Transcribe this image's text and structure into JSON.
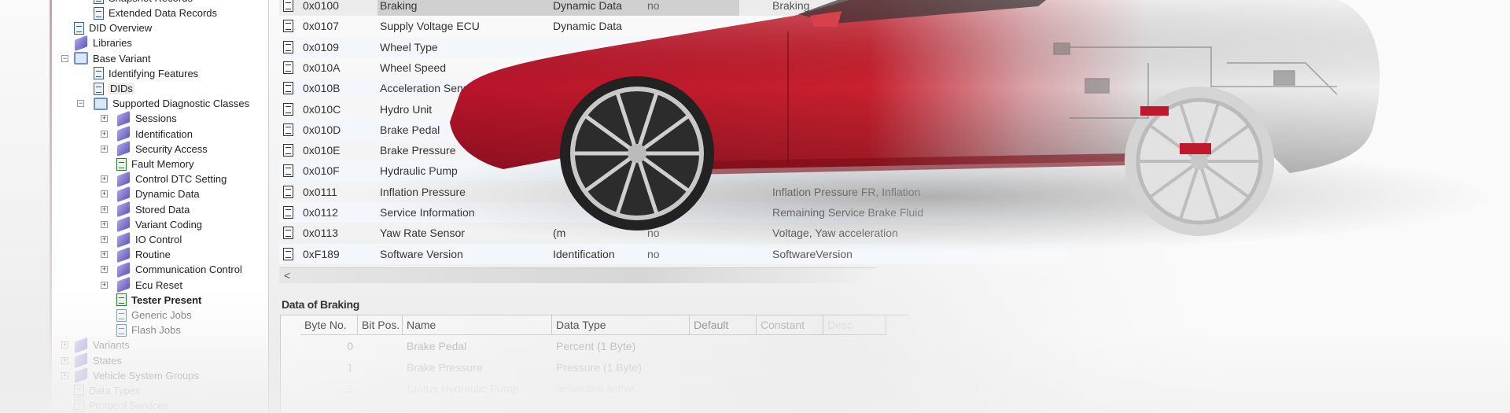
{
  "tree": [
    {
      "label": "Snapshot Records",
      "depth": 1,
      "icon": "document-icon",
      "exp": "",
      "style": "normal",
      "partial": true
    },
    {
      "label": "Extended Data Records",
      "depth": 1,
      "icon": "document-icon",
      "exp": "",
      "style": "normal"
    },
    {
      "label": "DID Overview",
      "depth": 0,
      "icon": "document-icon",
      "exp": "",
      "style": "normal"
    },
    {
      "label": "Libraries",
      "depth": 0,
      "icon": "book-icon",
      "exp": "",
      "style": "normal"
    },
    {
      "label": "Base Variant",
      "depth": 0,
      "icon": "open-book-icon",
      "exp": "-",
      "style": "normal"
    },
    {
      "label": "Identifying Features",
      "depth": 1,
      "icon": "document-icon",
      "exp": "",
      "style": "normal"
    },
    {
      "label": "DIDs",
      "depth": 1,
      "icon": "document-icon",
      "exp": "",
      "style": "selected"
    },
    {
      "label": "Supported Diagnostic Classes",
      "depth": 1,
      "icon": "open-book-icon",
      "exp": "-",
      "style": "normal"
    },
    {
      "label": "Sessions",
      "depth": 2,
      "icon": "book-icon",
      "exp": "+",
      "style": "normal"
    },
    {
      "label": "Identification",
      "depth": 2,
      "icon": "book-icon",
      "exp": "+",
      "style": "normal"
    },
    {
      "label": "Security Access",
      "depth": 2,
      "icon": "book-icon",
      "exp": "+",
      "style": "normal"
    },
    {
      "label": "Fault Memory",
      "depth": 2,
      "icon": "green-document-icon",
      "exp": "",
      "style": "normal"
    },
    {
      "label": "Control DTC Setting",
      "depth": 2,
      "icon": "book-icon",
      "exp": "+",
      "style": "normal"
    },
    {
      "label": "Dynamic Data",
      "depth": 2,
      "icon": "book-icon",
      "exp": "+",
      "style": "normal"
    },
    {
      "label": "Stored Data",
      "depth": 2,
      "icon": "book-icon",
      "exp": "+",
      "style": "normal"
    },
    {
      "label": "Variant Coding",
      "depth": 2,
      "icon": "book-icon",
      "exp": "+",
      "style": "normal"
    },
    {
      "label": "IO Control",
      "depth": 2,
      "icon": "book-icon",
      "exp": "+",
      "style": "normal"
    },
    {
      "label": "Routine",
      "depth": 2,
      "icon": "book-icon",
      "exp": "+",
      "style": "normal"
    },
    {
      "label": "Communication Control",
      "depth": 2,
      "icon": "book-icon",
      "exp": "+",
      "style": "normal"
    },
    {
      "label": "Ecu Reset",
      "depth": 2,
      "icon": "book-icon",
      "exp": "+",
      "style": "normal"
    },
    {
      "label": "Tester Present",
      "depth": 2,
      "icon": "green-document-icon",
      "exp": "",
      "style": "bold"
    },
    {
      "label": "Generic Jobs",
      "depth": 2,
      "icon": "job-document-icon",
      "exp": "",
      "style": "dim"
    },
    {
      "label": "Flash Jobs",
      "depth": 2,
      "icon": "job-document-icon",
      "exp": "",
      "style": "dim"
    },
    {
      "label": "Variants",
      "depth": 0,
      "icon": "book-icon",
      "exp": "+",
      "style": "faded"
    },
    {
      "label": "States",
      "depth": 0,
      "icon": "book-icon",
      "exp": "+",
      "style": "faded"
    },
    {
      "label": "Vehicle System Groups",
      "depth": 0,
      "icon": "book-icon",
      "exp": "+",
      "style": "faded"
    },
    {
      "label": "Data Types",
      "depth": 0,
      "icon": "document-icon",
      "exp": "",
      "style": "faded2"
    },
    {
      "label": "Protocol Services",
      "depth": 0,
      "icon": "document-icon",
      "exp": "",
      "style": "faded2"
    }
  ],
  "dids": [
    {
      "id": "0x0100",
      "name": "Braking",
      "cls": "Dynamic Data",
      "no": "no",
      "data": "Braking"
    },
    {
      "id": "0x0107",
      "name": "Supply Voltage ECU",
      "cls": "Dynamic Data",
      "no": "",
      "data": ""
    },
    {
      "id": "0x0109",
      "name": "Wheel Type",
      "cls": "",
      "no": "",
      "data": ""
    },
    {
      "id": "0x010A",
      "name": "Wheel Speed",
      "cls": "",
      "no": "",
      "data": ""
    },
    {
      "id": "0x010B",
      "name": "Acceleration Sensor",
      "cls": "",
      "no": "",
      "data": ""
    },
    {
      "id": "0x010C",
      "name": "Hydro Unit",
      "cls": "",
      "no": "",
      "data": ""
    },
    {
      "id": "0x010D",
      "name": "Brake Pedal",
      "cls": "",
      "no": "",
      "data": ""
    },
    {
      "id": "0x010E",
      "name": "Brake Pressure",
      "cls": "",
      "no": "",
      "data": ""
    },
    {
      "id": "0x010F",
      "name": "Hydraulic Pump",
      "cls": "",
      "no": "",
      "data": ""
    },
    {
      "id": "0x0111",
      "name": "Inflation Pressure",
      "cls": "",
      "no": "",
      "data": "Inflation Pressure FR, Inflation"
    },
    {
      "id": "0x0112",
      "name": "Service Information",
      "cls": "",
      "no": "no",
      "data": "Remaining Service Brake Fluid"
    },
    {
      "id": "0x0113",
      "name": "Yaw Rate Sensor",
      "cls": "(m",
      "no": "no",
      "data": "Voltage, Yaw acceleration"
    },
    {
      "id": "0xF189",
      "name": "Software Version",
      "cls": "Identification",
      "no": "no",
      "data": "SoftwareVersion"
    }
  ],
  "scroll_left": "<",
  "detail": {
    "title": "Data of Braking",
    "columns": [
      "Byte No.",
      "Bit Pos.",
      "Name",
      "Data Type",
      "Default",
      "Constant",
      "Desc"
    ],
    "rows": [
      {
        "byte": "0",
        "bit": "",
        "name": "Brake Pedal",
        "type": "Percent (1 Byte)"
      },
      {
        "byte": "1",
        "bit": "",
        "name": "Brake Pressure",
        "type": "Pressure (1 Byte)"
      },
      {
        "byte": "2",
        "bit": "",
        "name": "Status Hydraulic Pump",
        "type": "active/not active"
      }
    ]
  },
  "colors": {
    "car_red": "#c11a2b",
    "selection": "#d0d0d0",
    "book": "#6f68c8"
  }
}
